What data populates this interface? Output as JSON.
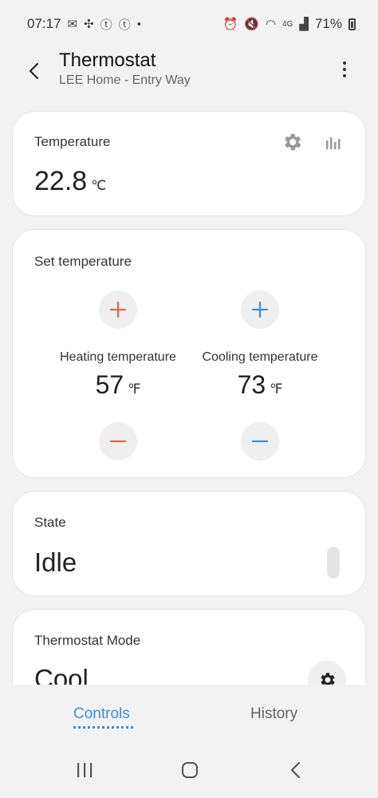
{
  "status_bar": {
    "time": "07:17",
    "network": "4G",
    "battery_percent": "71%",
    "left_icons": [
      "message-icon",
      "pinwheel-icon",
      "t-badge-icon",
      "t-badge-icon",
      "dot-icon"
    ],
    "right_icons": [
      "alarm-icon",
      "mute-icon",
      "wifi-icon",
      "signal-icon",
      "battery-icon"
    ]
  },
  "app_bar": {
    "title": "Thermostat",
    "subtitle": "LEE Home - Entry Way"
  },
  "temperature_card": {
    "label": "Temperature",
    "value": "22.8",
    "unit": "℃"
  },
  "set_temperature_card": {
    "label": "Set temperature",
    "heating": {
      "label": "Heating temperature",
      "value": "57",
      "unit": "℉",
      "color": "#e5634a"
    },
    "cooling": {
      "label": "Cooling temperature",
      "value": "73",
      "unit": "℉",
      "color": "#3a8fd6"
    }
  },
  "state_card": {
    "label": "State",
    "value": "Idle"
  },
  "mode_card": {
    "label": "Thermostat Mode",
    "value": "Cool"
  },
  "tabs": {
    "controls": "Controls",
    "history": "History",
    "active": "Controls"
  },
  "colors": {
    "accent": "#3a8fd6",
    "heating": "#e5634a"
  }
}
